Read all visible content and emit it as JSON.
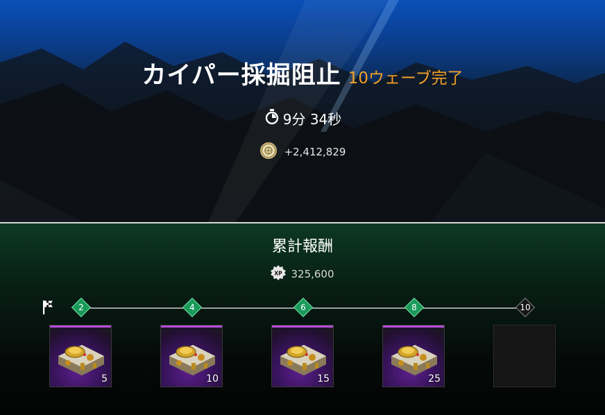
{
  "result": {
    "mission_title": "カイパー採掘阻止",
    "waves_completed": "10ウェーブ完了",
    "time": "9分 34秒",
    "credits": "+2,412,829"
  },
  "rewards": {
    "title": "累計報酬",
    "xp": "325,600",
    "xp_badge": "XP",
    "milestones": [
      {
        "wave": "2",
        "achieved": true,
        "quantity": "5",
        "item_icon": "gold-device-icon"
      },
      {
        "wave": "4",
        "achieved": true,
        "quantity": "10",
        "item_icon": "gold-device-icon"
      },
      {
        "wave": "6",
        "achieved": true,
        "quantity": "15",
        "item_icon": "gold-device-icon"
      },
      {
        "wave": "8",
        "achieved": true,
        "quantity": "25",
        "item_icon": "gold-device-icon"
      },
      {
        "wave": "10",
        "achieved": false,
        "quantity": "",
        "item_icon": ""
      }
    ]
  },
  "colors": {
    "accent_orange": "#f5a024",
    "milestone_green": "#1a9a5a",
    "rarity_purple": "#b64ed8"
  }
}
